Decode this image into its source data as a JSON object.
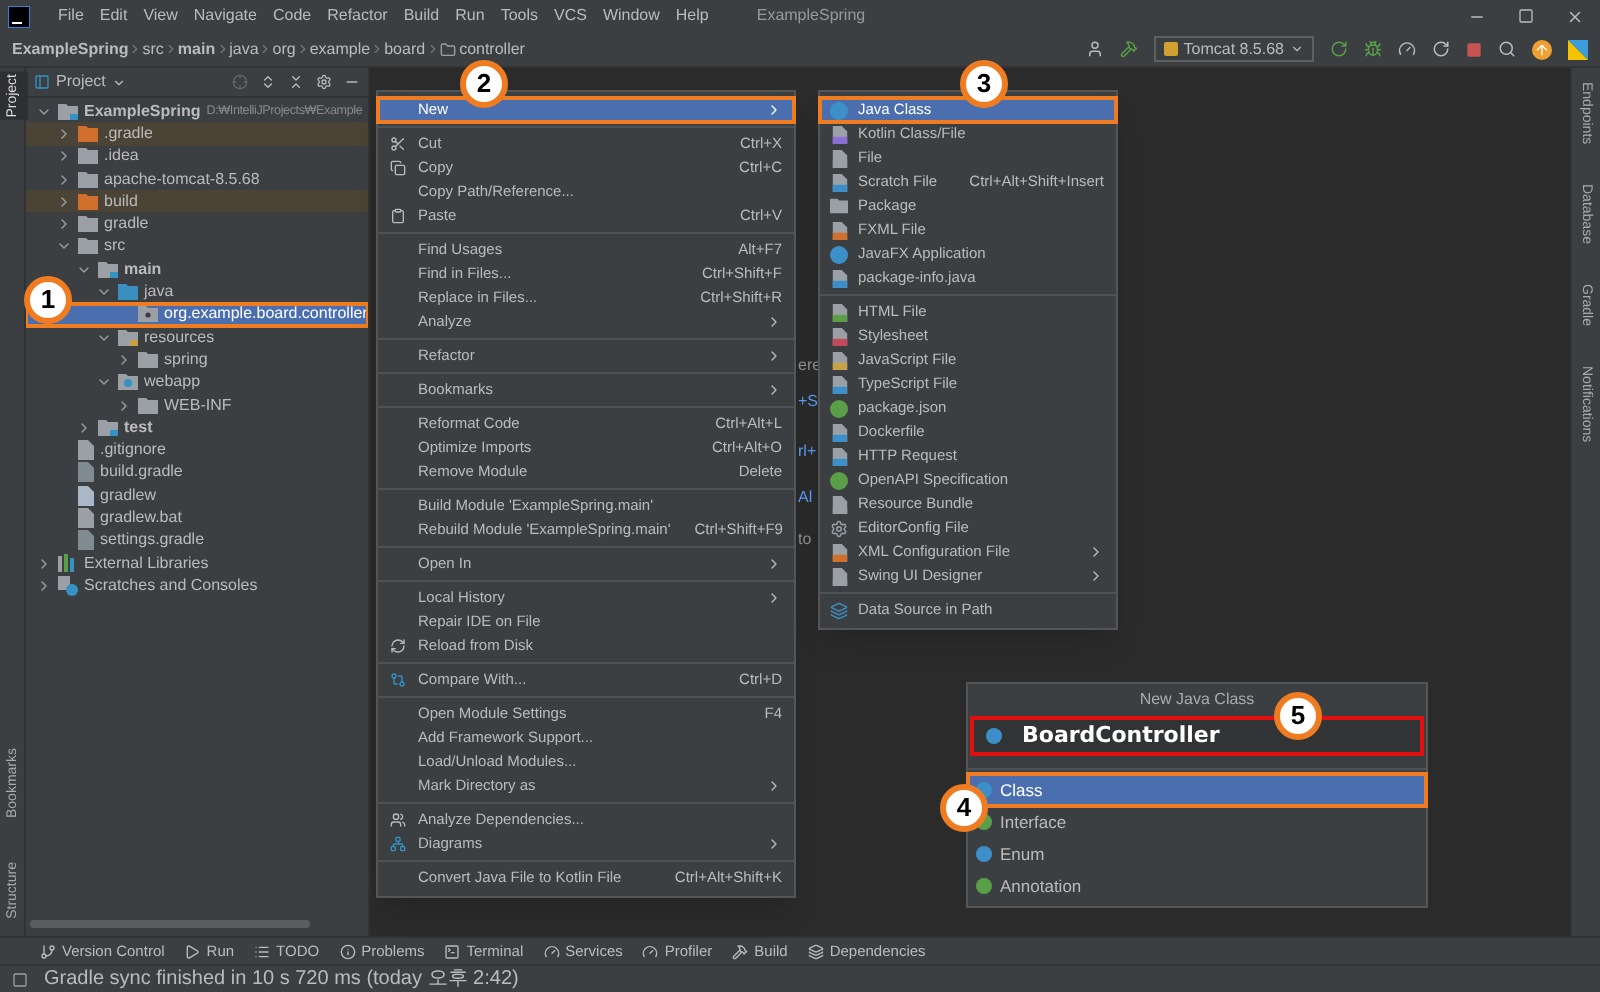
{
  "title_bar": {
    "menus": [
      "File",
      "Edit",
      "View",
      "Navigate",
      "Code",
      "Refactor",
      "Build",
      "Run",
      "Tools",
      "VCS",
      "Window",
      "Help"
    ],
    "title": "ExampleSpring"
  },
  "breadcrumb": [
    {
      "label": "ExampleSpring",
      "kind": "bold"
    },
    {
      "label": "src",
      "kind": "plain"
    },
    {
      "label": "main",
      "kind": "bold"
    },
    {
      "label": "java",
      "kind": "plain"
    },
    {
      "label": "org",
      "kind": "plain"
    },
    {
      "label": "example",
      "kind": "plain"
    },
    {
      "label": "board",
      "kind": "plain"
    },
    {
      "label": "controller",
      "kind": "folder"
    }
  ],
  "run_config": "Tomcat 8.5.68",
  "left_tabs": [
    {
      "label": "Project",
      "selected": true
    }
  ],
  "left_bottom_tabs": [
    "Bookmarks",
    "Structure"
  ],
  "right_tabs": [
    "Endpoints",
    "Database",
    "Gradle",
    "Notifications"
  ],
  "project_panel": {
    "title": "Project",
    "tree": [
      {
        "label": "ExampleSpring",
        "path": "D:₩IntelliJProjects₩Example",
        "kind": "module",
        "expanded": true,
        "selected": false,
        "children": [
          {
            "label": ".gradle",
            "kind": "excluded-folder",
            "expanded": false,
            "selected": false
          },
          {
            "label": ".idea",
            "kind": "folder",
            "expanded": false,
            "selected": false
          },
          {
            "label": "apache-tomcat-8.5.68",
            "kind": "folder",
            "expanded": false,
            "selected": false
          },
          {
            "label": "build",
            "kind": "excluded-folder",
            "expanded": false,
            "selected": false
          },
          {
            "label": "gradle",
            "kind": "folder",
            "expanded": false,
            "selected": false
          },
          {
            "label": "src",
            "kind": "folder",
            "expanded": true,
            "selected": false,
            "children": [
              {
                "label": "main",
                "kind": "source-set",
                "expanded": true,
                "selected": false,
                "children": [
                  {
                    "label": "java",
                    "kind": "source-root",
                    "expanded": true,
                    "selected": false,
                    "children": [
                      {
                        "label": "org.example.board.controller",
                        "kind": "package",
                        "selected": true
                      }
                    ]
                  },
                  {
                    "label": "resources",
                    "kind": "resources-root",
                    "expanded": true,
                    "selected": false,
                    "children": [
                      {
                        "label": "spring",
                        "kind": "folder",
                        "expanded": false,
                        "selected": false
                      }
                    ]
                  },
                  {
                    "label": "webapp",
                    "kind": "web-folder",
                    "expanded": true,
                    "selected": false,
                    "children": [
                      {
                        "label": "WEB-INF",
                        "kind": "folder",
                        "expanded": false,
                        "selected": false
                      }
                    ]
                  }
                ]
              },
              {
                "label": "test",
                "kind": "source-set",
                "expanded": false,
                "selected": false
              }
            ]
          },
          {
            "label": ".gitignore",
            "kind": "file-git",
            "selected": false
          },
          {
            "label": "build.gradle",
            "kind": "file-gradle",
            "selected": false
          },
          {
            "label": "gradlew",
            "kind": "file-script",
            "selected": false
          },
          {
            "label": "gradlew.bat",
            "kind": "file-bat",
            "selected": false
          },
          {
            "label": "settings.gradle",
            "kind": "file-gradle",
            "selected": false
          }
        ]
      },
      {
        "label": "External Libraries",
        "kind": "libraries",
        "expanded": false,
        "selected": false
      },
      {
        "label": "Scratches and Consoles",
        "kind": "scratches",
        "expanded": false,
        "selected": false
      }
    ]
  },
  "editor_fragments": [
    {
      "text": "ere",
      "kind": "plain"
    },
    {
      "text": "+S",
      "kind": "shortcut"
    },
    {
      "text": "rl+",
      "kind": "shortcut"
    },
    {
      "text": "Al",
      "kind": "shortcut"
    },
    {
      "text": "to",
      "kind": "plain"
    }
  ],
  "context_menu": {
    "groups": [
      [
        {
          "label": "New",
          "submenu": true,
          "selected": true
        }
      ],
      [
        {
          "label": "Cut",
          "shortcut": "Ctrl+X",
          "submenu": false,
          "selected": false
        },
        {
          "label": "Copy",
          "shortcut": "Ctrl+C",
          "submenu": false,
          "selected": false
        },
        {
          "label": "Copy Path/Reference...",
          "submenu": false,
          "selected": false
        },
        {
          "label": "Paste",
          "shortcut": "Ctrl+V",
          "submenu": false,
          "selected": false
        }
      ],
      [
        {
          "label": "Find Usages",
          "shortcut": "Alt+F7",
          "submenu": false,
          "selected": false
        },
        {
          "label": "Find in Files...",
          "shortcut": "Ctrl+Shift+F",
          "submenu": false,
          "selected": false
        },
        {
          "label": "Replace in Files...",
          "shortcut": "Ctrl+Shift+R",
          "submenu": false,
          "selected": false
        },
        {
          "label": "Analyze",
          "submenu": true,
          "selected": false
        }
      ],
      [
        {
          "label": "Refactor",
          "submenu": true,
          "selected": false
        }
      ],
      [
        {
          "label": "Bookmarks",
          "submenu": true,
          "selected": false
        }
      ],
      [
        {
          "label": "Reformat Code",
          "shortcut": "Ctrl+Alt+L",
          "submenu": false,
          "selected": false
        },
        {
          "label": "Optimize Imports",
          "shortcut": "Ctrl+Alt+O",
          "submenu": false,
          "selected": false
        },
        {
          "label": "Remove Module",
          "shortcut": "Delete",
          "submenu": false,
          "selected": false
        }
      ],
      [
        {
          "label": "Build Module 'ExampleSpring.main'",
          "submenu": false,
          "selected": false
        },
        {
          "label": "Rebuild Module 'ExampleSpring.main'",
          "shortcut": "Ctrl+Shift+F9",
          "submenu": false,
          "selected": false
        }
      ],
      [
        {
          "label": "Open In",
          "submenu": true,
          "selected": false
        }
      ],
      [
        {
          "label": "Local History",
          "submenu": true,
          "selected": false
        },
        {
          "label": "Repair IDE on File",
          "submenu": false,
          "selected": false
        },
        {
          "label": "Reload from Disk",
          "submenu": false,
          "selected": false
        }
      ],
      [
        {
          "label": "Compare With...",
          "shortcut": "Ctrl+D",
          "submenu": false,
          "selected": false
        }
      ],
      [
        {
          "label": "Open Module Settings",
          "shortcut": "F4",
          "submenu": false,
          "selected": false
        },
        {
          "label": "Add Framework Support...",
          "submenu": false,
          "selected": false
        },
        {
          "label": "Load/Unload Modules...",
          "submenu": false,
          "selected": false
        },
        {
          "label": "Mark Directory as",
          "submenu": true,
          "selected": false
        }
      ],
      [
        {
          "label": "Analyze Dependencies...",
          "submenu": false,
          "selected": false
        },
        {
          "label": "Diagrams",
          "submenu": true,
          "selected": false
        }
      ],
      [
        {
          "label": "Convert Java File to Kotlin File",
          "shortcut": "Ctrl+Alt+Shift+K",
          "submenu": false,
          "selected": false
        }
      ]
    ]
  },
  "new_submenu": {
    "groups": [
      [
        {
          "label": "Java Class",
          "submenu": false,
          "selected": true
        },
        {
          "label": "Kotlin Class/File",
          "submenu": false,
          "selected": false
        },
        {
          "label": "File",
          "submenu": false,
          "selected": false
        },
        {
          "label": "Scratch File",
          "shortcut": "Ctrl+Alt+Shift+Insert",
          "submenu": false,
          "selected": false
        },
        {
          "label": "Package",
          "submenu": false,
          "selected": false
        },
        {
          "label": "FXML File",
          "submenu": false,
          "selected": false
        },
        {
          "label": "JavaFX Application",
          "submenu": false,
          "selected": false
        },
        {
          "label": "package-info.java",
          "submenu": false,
          "selected": false
        }
      ],
      [
        {
          "label": "HTML File",
          "submenu": false,
          "selected": false
        },
        {
          "label": "Stylesheet",
          "submenu": false,
          "selected": false
        },
        {
          "label": "JavaScript File",
          "submenu": false,
          "selected": false
        },
        {
          "label": "TypeScript File",
          "submenu": false,
          "selected": false
        },
        {
          "label": "package.json",
          "submenu": false,
          "selected": false
        },
        {
          "label": "Dockerfile",
          "submenu": false,
          "selected": false
        },
        {
          "label": "HTTP Request",
          "submenu": false,
          "selected": false
        },
        {
          "label": "OpenAPI Specification",
          "submenu": false,
          "selected": false
        },
        {
          "label": "Resource Bundle",
          "submenu": false,
          "selected": false
        },
        {
          "label": "EditorConfig File",
          "submenu": false,
          "selected": false
        },
        {
          "label": "XML Configuration File",
          "submenu": true,
          "selected": false
        },
        {
          "label": "Swing UI Designer",
          "submenu": true,
          "selected": false
        }
      ],
      [
        {
          "label": "Data Source in Path",
          "submenu": false,
          "selected": false
        }
      ]
    ]
  },
  "new_class_dialog": {
    "title": "New Java Class",
    "name_field": {
      "value": "BoardController",
      "highlighted": true
    },
    "kinds": [
      {
        "label": "Class",
        "color": "#3d8fc9",
        "selected": true
      },
      {
        "label": "Interface",
        "color": "#5a9e48",
        "selected": false
      },
      {
        "label": "Enum",
        "color": "#3d8fc9",
        "selected": false
      },
      {
        "label": "Annotation",
        "color": "#5a9e48",
        "selected": false
      }
    ]
  },
  "callouts": [
    "1",
    "2",
    "3",
    "4",
    "5"
  ],
  "tool_windows": [
    "Version Control",
    "Run",
    "TODO",
    "Problems",
    "Terminal",
    "Services",
    "Profiler",
    "Build",
    "Dependencies"
  ],
  "status": "Gradle sync finished in 10 s 720 ms (today 오후 2:42)"
}
